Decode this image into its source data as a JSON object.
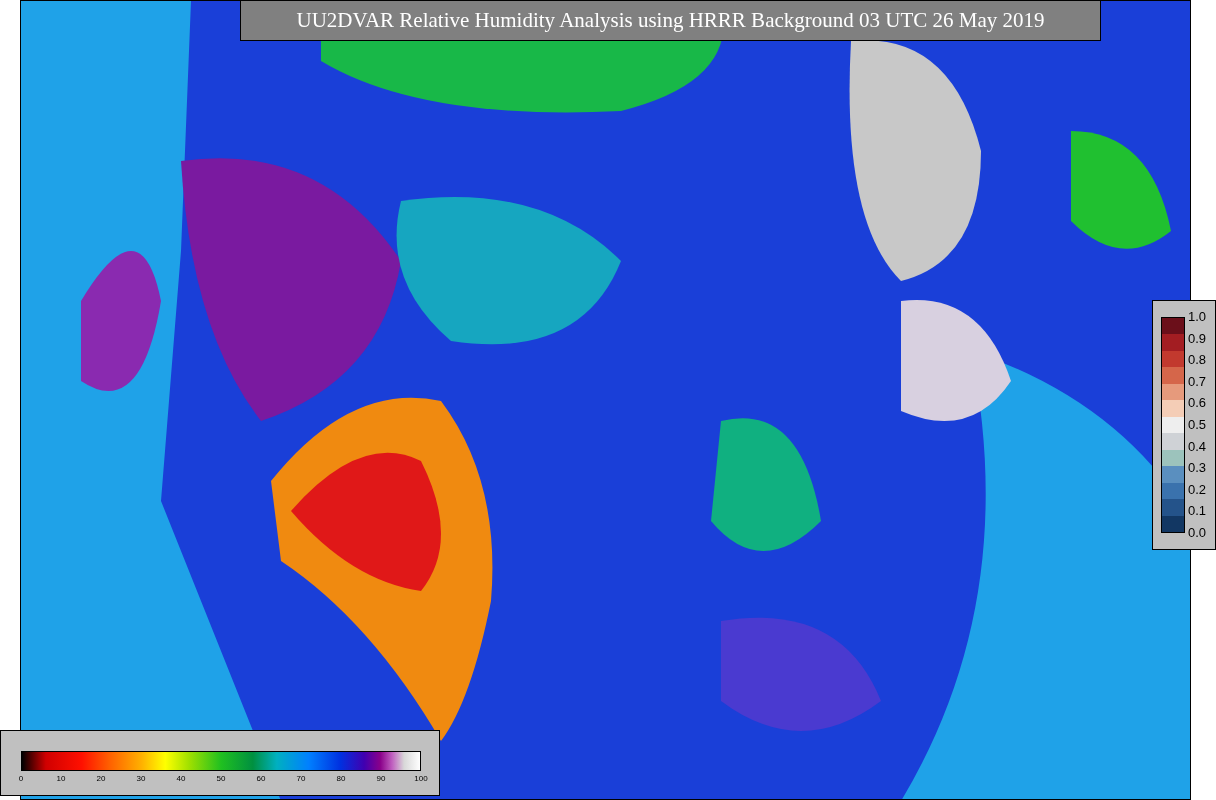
{
  "title": "UU2DVAR Relative Humidity Analysis using HRRR Background 03 UTC 26 May 2019",
  "colorbars": [
    {
      "kind": "vertical",
      "ticks": [
        "1.0",
        "0.9",
        "0.8",
        "0.7",
        "0.6",
        "0.5",
        "0.4",
        "0.3",
        "0.2",
        "0.1",
        "0.0"
      ]
    },
    {
      "kind": "horizontal",
      "ticks": [
        "0",
        "10",
        "20",
        "30",
        "40",
        "50",
        "60",
        "70",
        "80",
        "90",
        "100"
      ]
    }
  ]
}
